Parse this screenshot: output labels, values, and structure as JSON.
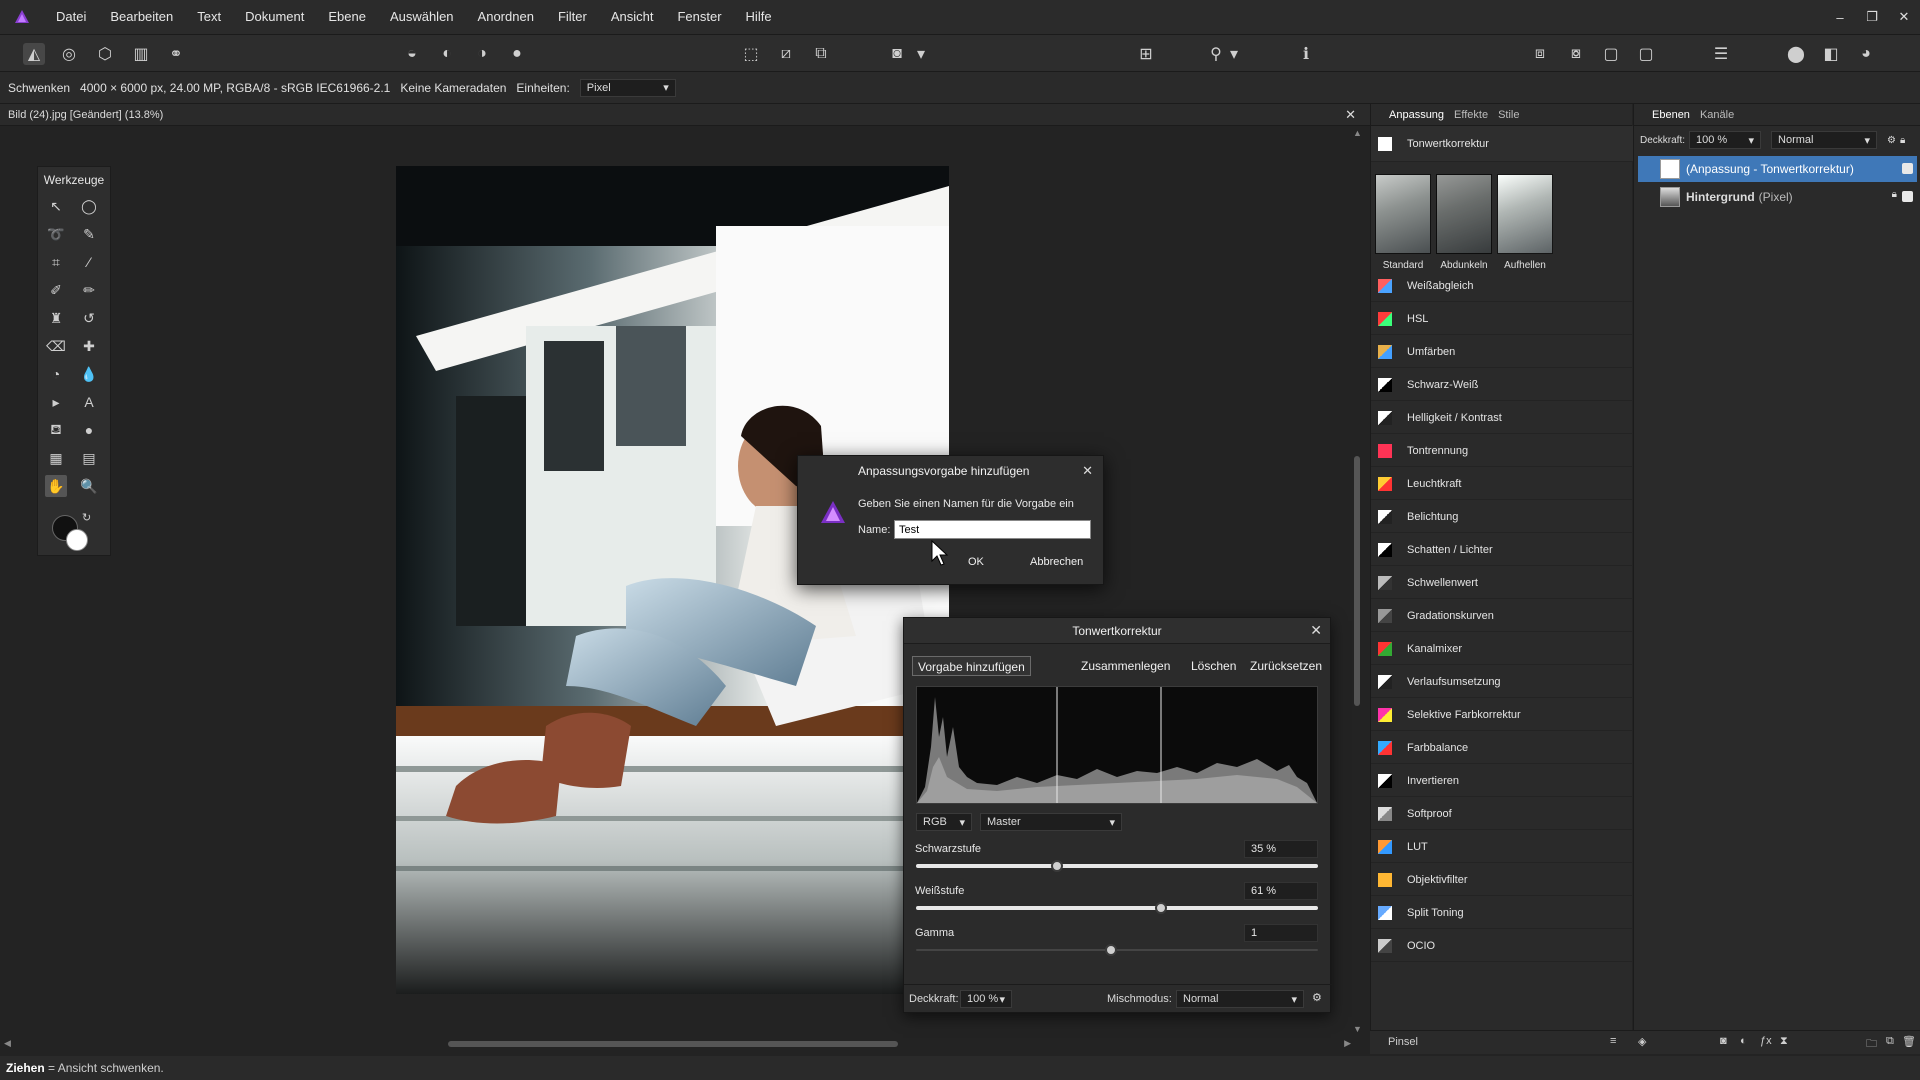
{
  "menubar": {
    "items": [
      "Datei",
      "Bearbeiten",
      "Text",
      "Dokument",
      "Ebene",
      "Auswählen",
      "Anordnen",
      "Filter",
      "Ansicht",
      "Fenster",
      "Hilfe"
    ]
  },
  "contextbar": {
    "tool": "Schwenken",
    "image_info": "4000 × 6000 px, 24.00 MP, RGBA/8 - sRGB IEC61966-2.1",
    "camera": "Keine Kameradaten",
    "units_label": "Einheiten:",
    "units_value": "Pixel"
  },
  "document": {
    "tab_title": "Bild (24).jpg [Geändert] (13.8%)"
  },
  "tools": {
    "title": "Werkzeuge"
  },
  "adjust_panel": {
    "tabs": [
      "Anpassung",
      "Effekte",
      "Stile"
    ],
    "header": "Tonwertkorrektur",
    "presets": [
      "Standard",
      "Abdunkeln",
      "Aufhellen"
    ],
    "items": [
      "Weißabgleich",
      "HSL",
      "Umfärben",
      "Schwarz-Weiß",
      "Helligkeit / Kontrast",
      "Tontrennung",
      "Leuchtkraft",
      "Belichtung",
      "Schatten / Lichter",
      "Schwellenwert",
      "Gradationskurven",
      "Kanalmixer",
      "Verlaufsumsetzung",
      "Selektive Farbkorrektur",
      "Farbbalance",
      "Invertieren",
      "Softproof",
      "LUT",
      "Objektivfilter",
      "Split Toning",
      "OCIO"
    ],
    "bottom_label": "Pinsel"
  },
  "layers_panel": {
    "tabs": [
      "Ebenen",
      "Kanäle"
    ],
    "opacity_label": "Deckkraft:",
    "opacity_value": "100 %",
    "blend_mode": "Normal",
    "layers": [
      {
        "name": "(Anpassung - Tonwertkorrektur)",
        "selected": true
      },
      {
        "name": "Hintergrund",
        "type": "(Pixel)",
        "selected": false
      }
    ]
  },
  "levels_dialog": {
    "title": "Tonwertkorrektur",
    "buttons": {
      "add_preset": "Vorgabe hinzufügen",
      "merge": "Zusammenlegen",
      "delete": "Löschen",
      "reset": "Zurücksetzen"
    },
    "channel": "RGB",
    "channel_mode": "Master",
    "black_label": "Schwarzstufe",
    "black_value": "35 %",
    "black_level": 0.35,
    "white_label": "Weißstufe",
    "white_value": "61 %",
    "white_level": 0.61,
    "gamma_label": "Gamma",
    "gamma_value": "1",
    "opacity_label": "Deckkraft:",
    "opacity_value": "100 %",
    "blend_label": "Mischmodus:",
    "blend_value": "Normal"
  },
  "preset_dialog": {
    "title": "Anpassungsvorgabe hinzufügen",
    "message": "Geben Sie einen Namen für die Vorgabe ein",
    "name_label": "Name:",
    "name_value": "Test",
    "ok": "OK",
    "cancel": "Abbrechen"
  },
  "statusbar": {
    "action": "Ziehen",
    "description": "= Ansicht schwenken."
  },
  "colors": {
    "accent": "#3f78b8",
    "app_logo": "#8a3fd1"
  }
}
